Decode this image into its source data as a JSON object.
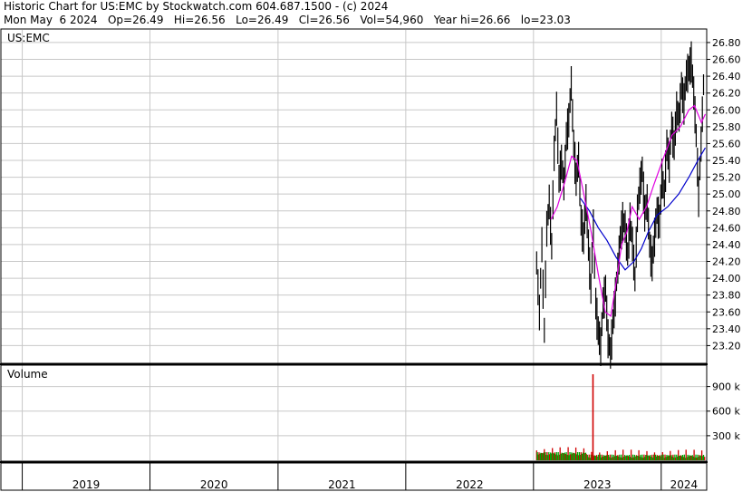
{
  "header": {
    "line1": "Historic Chart for US:EMC by Stockwatch.com 604.687.1500 - (c) 2024",
    "line2": "Mon May  6 2024   Op=26.49   Hi=26.56   Lo=26.49   Cl=26.56   Vol=54,960   Year hi=26.66   lo=23.03"
  },
  "chart_data": {
    "type": "line",
    "symbol": "US:EMC",
    "price_axis": {
      "ticks": [
        "26.80",
        "26.60",
        "26.40",
        "26.20",
        "26.00",
        "25.80",
        "25.60",
        "25.40",
        "25.20",
        "25.00",
        "24.80",
        "24.60",
        "24.40",
        "24.20",
        "24.00",
        "23.80",
        "23.60",
        "23.40",
        "23.20"
      ],
      "range": [
        23.0,
        26.95
      ]
    },
    "volume_panel": {
      "label": "Volume",
      "ticks": [
        "900 k",
        "600 k",
        "300 k"
      ],
      "range": [
        0,
        1150000
      ]
    },
    "year_labels": [
      "2019",
      "2020",
      "2021",
      "2022",
      "2023",
      "2024"
    ],
    "x_range": [
      "2018-11-01",
      "2024-05-10"
    ],
    "colors": {
      "price_bar": "#000000",
      "ma_short": "#e000e0",
      "ma_long": "#0000cc",
      "vol_up": "#00a000",
      "vol_down": "#d00000",
      "grid": "#c8c8c8"
    },
    "ma_short": [
      [
        "2023-02-20",
        24.7
      ],
      [
        "2023-03-10",
        24.85
      ],
      [
        "2023-04-01",
        25.15
      ],
      [
        "2023-04-20",
        25.45
      ],
      [
        "2023-05-05",
        25.4
      ],
      [
        "2023-05-25",
        25.0
      ],
      [
        "2023-06-15",
        24.55
      ],
      [
        "2023-07-05",
        24.05
      ],
      [
        "2023-07-25",
        23.6
      ],
      [
        "2023-08-10",
        23.55
      ],
      [
        "2023-08-25",
        23.95
      ],
      [
        "2023-09-10",
        24.4
      ],
      [
        "2023-09-25",
        24.55
      ],
      [
        "2023-10-10",
        24.85
      ],
      [
        "2023-10-30",
        24.7
      ],
      [
        "2023-11-20",
        24.85
      ],
      [
        "2023-12-10",
        25.1
      ],
      [
        "2024-01-05",
        25.4
      ],
      [
        "2024-02-01",
        25.7
      ],
      [
        "2024-02-25",
        25.8
      ],
      [
        "2024-03-20",
        26.0
      ],
      [
        "2024-04-05",
        26.05
      ],
      [
        "2024-04-25",
        25.85
      ],
      [
        "2024-05-06",
        25.95
      ]
    ],
    "ma_long": [
      [
        "2023-05-15",
        24.95
      ],
      [
        "2023-06-10",
        24.8
      ],
      [
        "2023-07-05",
        24.6
      ],
      [
        "2023-07-30",
        24.45
      ],
      [
        "2023-08-25",
        24.25
      ],
      [
        "2023-09-20",
        24.1
      ],
      [
        "2023-10-15",
        24.2
      ],
      [
        "2023-11-05",
        24.35
      ],
      [
        "2023-11-25",
        24.55
      ],
      [
        "2023-12-20",
        24.75
      ],
      [
        "2024-01-20",
        24.85
      ],
      [
        "2024-02-20",
        25.0
      ],
      [
        "2024-03-20",
        25.2
      ],
      [
        "2024-04-15",
        25.4
      ],
      [
        "2024-05-06",
        25.55
      ]
    ],
    "price_path": [
      [
        "2023-01-10",
        24.2
      ],
      [
        "2023-01-18",
        23.6
      ],
      [
        "2023-01-25",
        24.4
      ],
      [
        "2023-02-01",
        23.4
      ],
      [
        "2023-02-08",
        24.6
      ],
      [
        "2023-02-15",
        24.9
      ],
      [
        "2023-02-22",
        24.4
      ],
      [
        "2023-03-01",
        25.5
      ],
      [
        "2023-03-08",
        26.0
      ],
      [
        "2023-03-15",
        25.2
      ],
      [
        "2023-03-22",
        25.4
      ],
      [
        "2023-03-29",
        25.1
      ],
      [
        "2023-04-05",
        25.7
      ],
      [
        "2023-04-12",
        25.9
      ],
      [
        "2023-04-19",
        26.3
      ],
      [
        "2023-04-26",
        25.6
      ],
      [
        "2023-05-03",
        25.2
      ],
      [
        "2023-05-10",
        25.4
      ],
      [
        "2023-05-17",
        24.7
      ],
      [
        "2023-05-24",
        24.5
      ],
      [
        "2023-05-31",
        24.9
      ],
      [
        "2023-06-07",
        24.4
      ],
      [
        "2023-06-14",
        23.9
      ],
      [
        "2023-06-21",
        24.6
      ],
      [
        "2023-06-28",
        23.7
      ],
      [
        "2023-07-05",
        23.4
      ],
      [
        "2023-07-12",
        23.2
      ],
      [
        "2023-07-19",
        23.7
      ],
      [
        "2023-07-26",
        23.9
      ],
      [
        "2023-08-02",
        23.3
      ],
      [
        "2023-08-09",
        23.1
      ],
      [
        "2023-08-16",
        23.5
      ],
      [
        "2023-08-23",
        23.8
      ],
      [
        "2023-08-30",
        24.1
      ],
      [
        "2023-09-06",
        24.5
      ],
      [
        "2023-09-13",
        24.7
      ],
      [
        "2023-09-20",
        24.6
      ],
      [
        "2023-09-27",
        24.3
      ],
      [
        "2023-10-04",
        24.7
      ],
      [
        "2023-10-11",
        24.4
      ],
      [
        "2023-10-18",
        24.0
      ],
      [
        "2023-10-25",
        24.8
      ],
      [
        "2023-11-01",
        25.1
      ],
      [
        "2023-11-08",
        25.3
      ],
      [
        "2023-11-15",
        24.8
      ],
      [
        "2023-11-22",
        24.9
      ],
      [
        "2023-11-29",
        24.4
      ],
      [
        "2023-12-06",
        24.2
      ],
      [
        "2023-12-13",
        24.5
      ],
      [
        "2023-12-20",
        24.8
      ],
      [
        "2023-12-27",
        24.7
      ],
      [
        "2024-01-03",
        25.2
      ],
      [
        "2024-01-10",
        25.0
      ],
      [
        "2024-01-17",
        25.6
      ],
      [
        "2024-01-24",
        25.4
      ],
      [
        "2024-01-31",
        25.8
      ],
      [
        "2024-02-07",
        25.6
      ],
      [
        "2024-02-14",
        26.0
      ],
      [
        "2024-02-21",
        25.9
      ],
      [
        "2024-02-28",
        26.3
      ],
      [
        "2024-03-06",
        26.1
      ],
      [
        "2024-03-13",
        26.4
      ],
      [
        "2024-03-20",
        26.5
      ],
      [
        "2024-03-27",
        26.6
      ],
      [
        "2024-04-03",
        26.2
      ],
      [
        "2024-04-10",
        25.7
      ],
      [
        "2024-04-17",
        25.0
      ],
      [
        "2024-04-24",
        25.6
      ],
      [
        "2024-05-01",
        26.3
      ],
      [
        "2024-05-06",
        26.56
      ]
    ],
    "volume_spike": [
      "2023-06-20",
      1050000
    ]
  }
}
